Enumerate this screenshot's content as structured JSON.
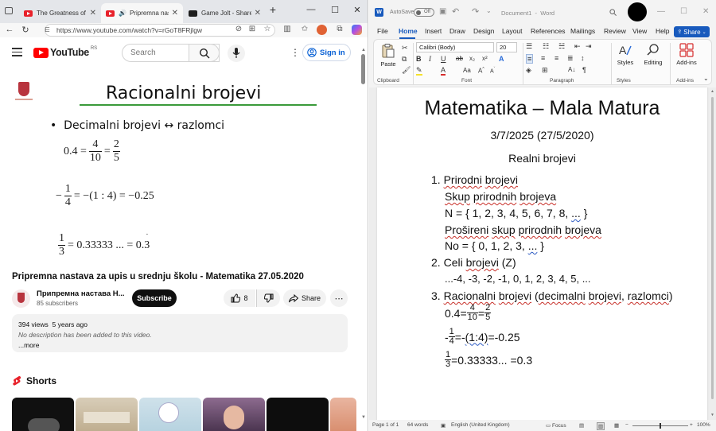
{
  "browser": {
    "tabs": [
      {
        "title": "The Greatness of Olde",
        "icon": "youtube-icon"
      },
      {
        "title": "Pripremna nasta",
        "icon": "youtube-icon",
        "active": true,
        "audio": true
      },
      {
        "title": "Game Jolt - Share yo",
        "icon": "gamejolt-icon"
      }
    ],
    "new_tab": "+",
    "window_controls": [
      "—",
      "☐",
      "✕"
    ],
    "url": "https://www.youtube.com/watch?v=rGoT8FRjlgw",
    "youtube": {
      "logo_text": "YouTube",
      "country": "RS",
      "search_placeholder": "Search",
      "sign_in": "Sign in",
      "video_slide": {
        "heading": "Racionalni brojevi",
        "bullet": "Decimalni brojevi ↔ razlomci",
        "eq1_left": "0.4 =",
        "eq1_f1_num": "4",
        "eq1_f1_den": "10",
        "eq1_mid": "=",
        "eq1_f2_num": "2",
        "eq1_f2_den": "5",
        "eq2_prefix": "−",
        "eq2_num": "1",
        "eq2_den": "4",
        "eq2_rest": "= −(1 : 4) = −0.25",
        "eq3_num": "1",
        "eq3_den": "3",
        "eq3_rest": "= 0.33333 ... = 0.3"
      },
      "video_title": "Pripremna nastava za upis u srednju školu - Matematika 27.05.2020",
      "channel_name": "Припремна настава Н...",
      "subscribers": "85 subscribers",
      "subscribe": "Subscribe",
      "likes": "8",
      "share": "Share",
      "views": "394 views",
      "age": "5 years ago",
      "description": "No description has been added to this video.",
      "more": "...more",
      "shorts": "Shorts"
    }
  },
  "word": {
    "autosave": "AutoSave",
    "autosave_state": "Off",
    "doc_name": "Document1",
    "app_name": "Word",
    "tabs": [
      "File",
      "Home",
      "Insert",
      "Draw",
      "Design",
      "Layout",
      "References",
      "Mailings",
      "Review",
      "View",
      "Help"
    ],
    "active_tab": "Home",
    "share": "Share",
    "ribbon": {
      "paste": "Paste",
      "font": "Calibri (Body)",
      "size": "20",
      "groups": [
        "Clipboard",
        "Font",
        "Paragraph",
        "Styles"
      ],
      "styles": "Styles",
      "editing": "Editing",
      "addins": "Add-ins",
      "addins_group": "Add-ins"
    },
    "doc": {
      "title": "Matematika – Mala Matura",
      "date": "3/7/2025 (27/5/2020)",
      "subtitle": "Realni brojevi",
      "i1_num": "1.",
      "i1_a": "Prirodni",
      "i1_b": "brojevi",
      "i1_l2a": "Skup",
      "i1_l2b": "prirodnih",
      "i1_l2c": "brojeva",
      "i1_l3": "N = { 1, 2, 3, 4, 5, 6, 7, 8, ",
      "i1_l3_dots": "...",
      "i1_l3_end": " }",
      "i1_l4a": "Prošireni",
      "i1_l4b": "skup",
      "i1_l4c": "prirodnih",
      "i1_l4d": "brojeva",
      "i1_l5": "No = { 0, 1, 2, 3, ",
      "i1_l5_dots": "...",
      "i1_l5_end": " }",
      "i2_num": "2.",
      "i2_a": "Celi",
      "i2_b": "brojevi",
      "i2_c": "(Z)",
      "i2_l2": "...-4, -3, -2, -1, 0, 1, 2, 3, 4, 5, ...",
      "i3_num": "3.",
      "i3_a": "Racionalni",
      "i3_b": "brojevi",
      "i3_c": "(",
      "i3_d": "decimalni",
      "i3_e": "brojevi",
      ", ": "",
      "i3_f": "razlomci",
      "i3_g": ")",
      "f1_left": "0.4=",
      "f1_n1": "4",
      "f1_d1": "10",
      "f1_mid": "=",
      "f1_n2": "2",
      "f1_d2": "5",
      "f2_pre": "-",
      "f2_n": "1",
      "f2_d": "4",
      "f2_mid": "=-",
      "f2_par": "(1:4)",
      "f2_end": "=-0.25",
      "f3_n": "1",
      "f3_d": "3",
      "f3_end": "=0.33333... =0.3"
    },
    "status": {
      "page": "Page 1 of 1",
      "words": "64 words",
      "language": "English (United Kingdom)",
      "focus": "Focus",
      "zoom": "100%"
    }
  }
}
